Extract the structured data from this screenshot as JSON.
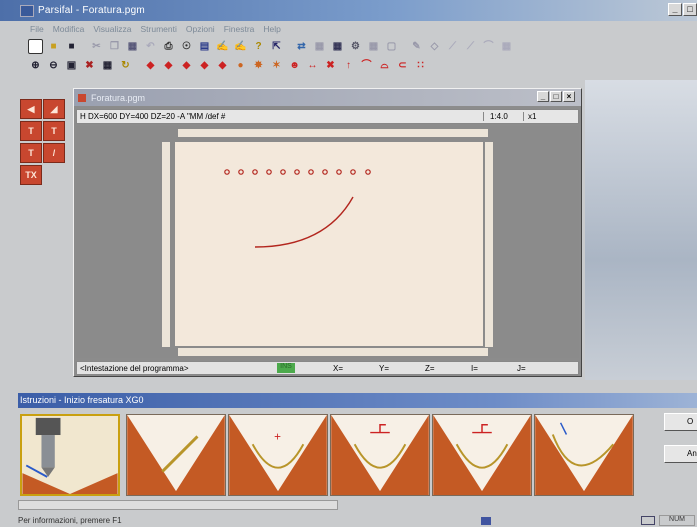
{
  "app": {
    "title": "Parsifal - Foratura.pgm"
  },
  "menu": [
    "File",
    "Modifica",
    "Visualizza",
    "Strumenti",
    "Opzioni",
    "Finestra",
    "Help"
  ],
  "document": {
    "title": "Foratura.pgm",
    "command_line": "H DX=600 DY=400 DZ=20 -A \"MM /def #",
    "scale": "1:4.0",
    "multiplier": "x1",
    "status_hint": "<Intestazione del programma>",
    "status_ins": "INS",
    "coords": [
      "X=",
      "Y=",
      "Z=",
      "I=",
      "J="
    ]
  },
  "instructions": {
    "title": "Istruzioni - Inizio fresatura XG0"
  },
  "side_buttons": [
    "O",
    "Ann"
  ],
  "statusbar": {
    "message": "Per informazioni, premere F1",
    "num": "NUM"
  },
  "colors": {
    "accent": "#c8472f",
    "titlebar": "#4d6fa9",
    "sheet": "#f3e8db",
    "tile_orange": "#c45a24"
  },
  "icons": {
    "toolbar1": [
      "new-icon",
      "open-icon",
      "save-icon",
      "cut-icon",
      "copy-icon",
      "paste-icon",
      "undo-icon",
      "print-icon",
      "target-icon",
      "drill-icon",
      "tool-icon",
      "tool2-icon",
      "help-icon",
      "context-help-icon",
      "flip-icon",
      "grid-icon",
      "table-icon",
      "settings-icon",
      "calc-icon",
      "view-icon",
      "pencil-icon",
      "shape-icon",
      "line-icon",
      "cursor-icon",
      "arc-icon",
      "keypad-icon"
    ],
    "toolbar2": [
      "zoom-in-icon",
      "zoom-out-icon",
      "zoom-window-icon",
      "zoom-all-icon",
      "pan-icon",
      "redraw-icon",
      "layer1-icon",
      "layer2-icon",
      "layer3-icon",
      "layer4-icon",
      "layer5-icon",
      "snap-icon",
      "snap2-icon",
      "snap3-icon",
      "person-icon",
      "move-x-icon",
      "mirror-x-icon",
      "mirror-y-icon",
      "arc-cw-icon",
      "arc-ccw-icon",
      "chamfer-icon",
      "grid-dots-icon"
    ]
  }
}
